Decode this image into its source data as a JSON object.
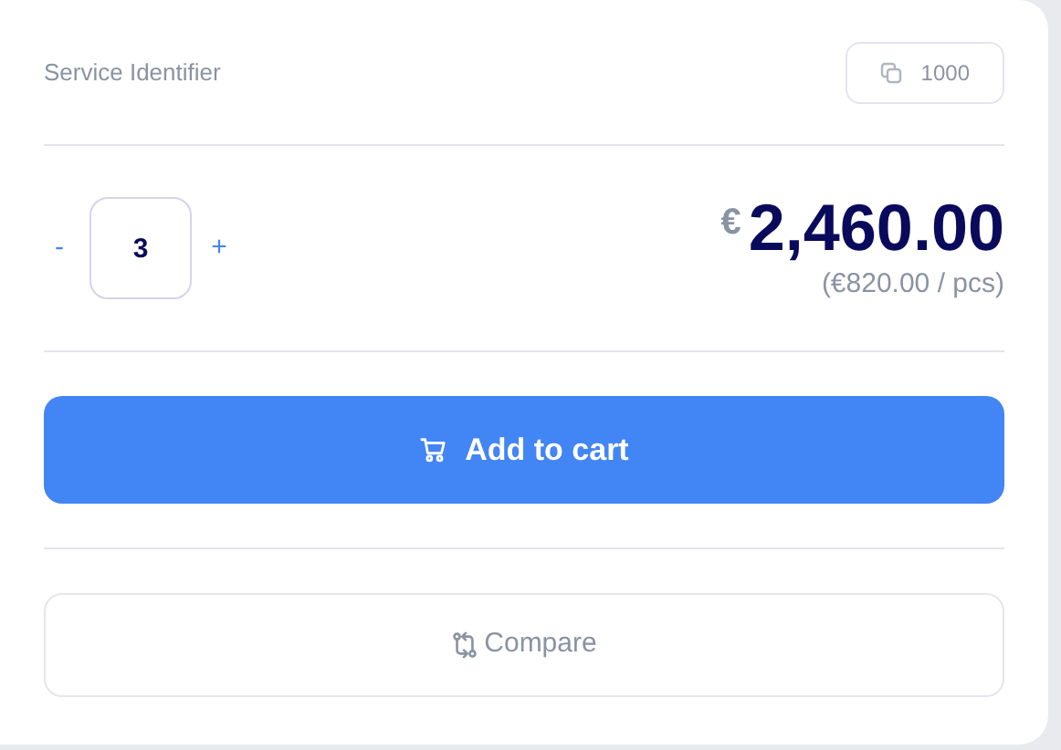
{
  "service": {
    "label": "Service Identifier",
    "id": "1000"
  },
  "quantity": {
    "decrement": "-",
    "value": "3",
    "increment": "+"
  },
  "price": {
    "currency": "€",
    "total": "2,460.00",
    "unit": "(€820.00 / pcs)"
  },
  "buttons": [
    {
      "kind": "cart",
      "label": "Add to cart"
    },
    {
      "kind": "compare",
      "label": "Compare"
    }
  ]
}
